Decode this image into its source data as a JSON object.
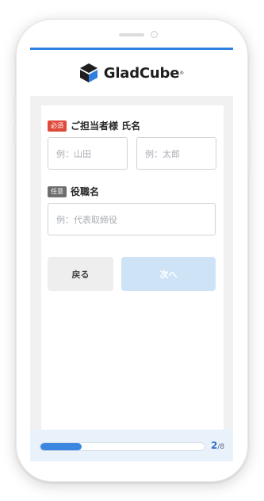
{
  "brand": {
    "name": "GladCube",
    "reg_mark": "®"
  },
  "form": {
    "name_field": {
      "badge": "必須",
      "label": "ご担当者様 氏名",
      "last_placeholder": "例：山田",
      "first_placeholder": "例：太郎"
    },
    "title_field": {
      "badge": "任意",
      "label": "役職名",
      "placeholder": "例：代表取締役"
    }
  },
  "buttons": {
    "back_label": "戻る",
    "next_label": "次へ"
  },
  "progress": {
    "current": "2",
    "total": "/8",
    "fraction": 0.25
  },
  "colors": {
    "accent": "#2f7fe0",
    "required_badge": "#e04a3b",
    "optional_badge": "#6e6e6e",
    "next_disabled": "#cfe3f7",
    "progress_fill": "#3a86e0"
  },
  "icons": {
    "logo": "cube-logo-icon"
  }
}
